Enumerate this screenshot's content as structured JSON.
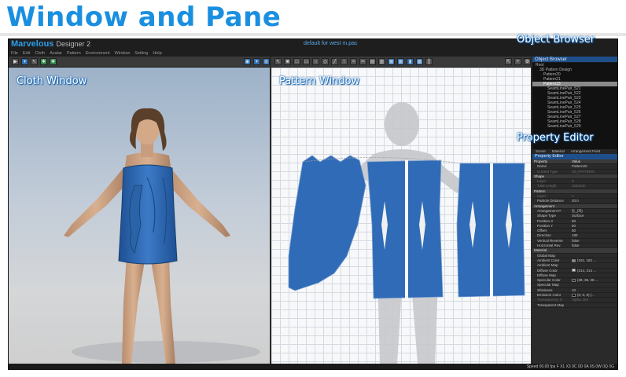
{
  "slide": {
    "title": "Window and Pane"
  },
  "app": {
    "brand": "Marvelous",
    "brand_sub": "Designer 2",
    "filename": "default for west m.pac"
  },
  "menu": [
    "File",
    "Edit",
    "Cloth",
    "Avatar",
    "Pattern",
    "Environment",
    "Window",
    "Setting",
    "Help"
  ],
  "labels": {
    "cloth_window": "Cloth Window",
    "pattern_window": "Pattern Window",
    "object_browser": "Object Browser",
    "property_editor": "Property Editor"
  },
  "object_browser": {
    "title": "Object Browser",
    "tree": [
      {
        "label": "Root",
        "indent": 0
      },
      {
        "label": "3D Pattern Design",
        "indent": 1
      },
      {
        "label": "Pattern20",
        "indent": 2
      },
      {
        "label": "Pattern21",
        "indent": 2
      },
      {
        "label": "Pattern23",
        "indent": 2,
        "selected": true
      },
      {
        "label": "SeamLinePair_521",
        "indent": 3
      },
      {
        "label": "SeamLinePair_522",
        "indent": 3
      },
      {
        "label": "SeamLinePair_523",
        "indent": 3
      },
      {
        "label": "SeamLinePair_524",
        "indent": 3
      },
      {
        "label": "SeamLinePair_525",
        "indent": 3
      },
      {
        "label": "SeamLinePair_526",
        "indent": 3
      },
      {
        "label": "SeamLinePair_527",
        "indent": 3
      },
      {
        "label": "SeamLinePair_528",
        "indent": 3
      },
      {
        "label": "SeamLinePair_529",
        "indent": 3
      }
    ],
    "tabs": [
      "Scene",
      "Material",
      "Arrangement Point"
    ]
  },
  "property_editor": {
    "title": "Property Editor",
    "rows": [
      {
        "k": "Property",
        "v": "Value",
        "type": "sec"
      },
      {
        "k": "Name",
        "v": "Pattern20"
      },
      {
        "k": "Current Type",
        "v": "3D_PATTERN",
        "type": "dim"
      },
      {
        "k": "Shape",
        "v": "",
        "type": "sec"
      },
      {
        "k": "Layer",
        "v": "0",
        "type": "dim"
      },
      {
        "k": "Total Length",
        "v": "2284mm",
        "type": "dim"
      },
      {
        "k": "Pattern",
        "v": "",
        "type": "sec"
      },
      {
        "k": "Layer",
        "v": "1",
        "type": "dim"
      },
      {
        "k": "Particle Distance",
        "v": "20.0"
      },
      {
        "k": "Arrangement",
        "v": "",
        "type": "sec"
      },
      {
        "k": "Arrangement P.",
        "v": "등_(좌)"
      },
      {
        "k": "Shape Type",
        "v": "Surface"
      },
      {
        "k": "Position X",
        "v": "50"
      },
      {
        "k": "Position Y",
        "v": "50"
      },
      {
        "k": "Offset",
        "v": "50"
      },
      {
        "k": "Direction",
        "v": "180"
      },
      {
        "k": "Vertical Reverse",
        "v": "false"
      },
      {
        "k": "Horizontal Rev.",
        "v": "false"
      },
      {
        "k": "Material",
        "v": "",
        "type": "sec"
      },
      {
        "k": "Global Map",
        "v": ""
      },
      {
        "k": "Ambient Color",
        "v": "(191, 182 ...",
        "swatch": "#8c8c8c"
      },
      {
        "k": "Ambient Map",
        "v": ""
      },
      {
        "k": "Diffuse Color",
        "v": "(214, 214 ...",
        "swatch": "#d6d6d6"
      },
      {
        "k": "Diffuse Map",
        "v": ""
      },
      {
        "k": "Specular Color",
        "v": "(38, 38, 38 ...",
        "swatch": "#262626"
      },
      {
        "k": "Specular Map",
        "v": ""
      },
      {
        "k": "Shininess",
        "v": "10"
      },
      {
        "k": "Emission Color",
        "v": "(0, 0, 0) (...",
        "swatch": "#000000"
      },
      {
        "k": "Transparency S.",
        "v": "Alpha, Det",
        "type": "dim"
      },
      {
        "k": "Transparent Map",
        "v": ""
      }
    ]
  },
  "status": {
    "text": "Speed 00.00 fps  F X1 X3 0C 0D 0A 0S 0W 0Q 0G"
  },
  "colors": {
    "accent": "#1a8fe0",
    "cloth": "#2f6bb6",
    "panel_dark": "#2a2a2a",
    "header_blue": "#1f4f8a"
  }
}
